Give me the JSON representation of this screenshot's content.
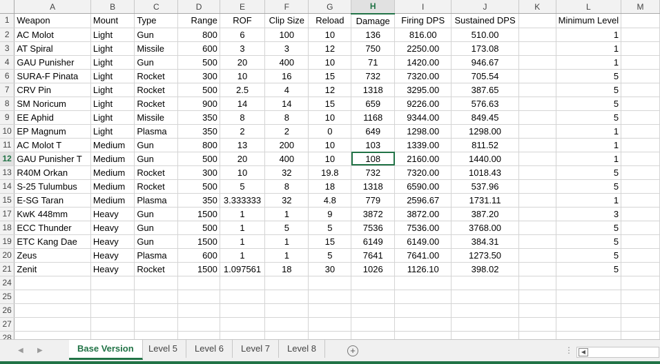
{
  "columns": [
    "A",
    "B",
    "C",
    "D",
    "E",
    "F",
    "G",
    "H",
    "I",
    "J",
    "K",
    "L",
    "M"
  ],
  "active_column": "H",
  "active_row": 12,
  "rows": [
    {
      "n": "1",
      "cells": [
        "Weapon",
        "Mount",
        "Type",
        "Range",
        "ROF",
        "Clip Size",
        "Reload",
        "Damage",
        "Firing DPS",
        "Sustained DPS",
        "",
        "Minimum Level",
        ""
      ]
    },
    {
      "n": "2",
      "cells": [
        "AC Molot",
        "Light",
        "Gun",
        "800",
        "6",
        "100",
        "10",
        "136",
        "816.00",
        "510.00",
        "",
        "1",
        ""
      ]
    },
    {
      "n": "3",
      "cells": [
        "AT Spiral",
        "Light",
        "Missile",
        "600",
        "3",
        "3",
        "12",
        "750",
        "2250.00",
        "173.08",
        "",
        "1",
        ""
      ]
    },
    {
      "n": "4",
      "cells": [
        "GAU Punisher",
        "Light",
        "Gun",
        "500",
        "20",
        "400",
        "10",
        "71",
        "1420.00",
        "946.67",
        "",
        "1",
        ""
      ]
    },
    {
      "n": "6",
      "cells": [
        "SURA-F Pinata",
        "Light",
        "Rocket",
        "300",
        "10",
        "16",
        "15",
        "732",
        "7320.00",
        "705.54",
        "",
        "5",
        ""
      ]
    },
    {
      "n": "7",
      "cells": [
        "CRV Pin",
        "Light",
        "Rocket",
        "500",
        "2.5",
        "4",
        "12",
        "1318",
        "3295.00",
        "387.65",
        "",
        "5",
        ""
      ]
    },
    {
      "n": "8",
      "cells": [
        "SM Noricum",
        "Light",
        "Rocket",
        "900",
        "14",
        "14",
        "15",
        "659",
        "9226.00",
        "576.63",
        "",
        "5",
        ""
      ]
    },
    {
      "n": "9",
      "cells": [
        "EE Aphid",
        "Light",
        "Missile",
        "350",
        "8",
        "8",
        "10",
        "1168",
        "9344.00",
        "849.45",
        "",
        "5",
        ""
      ]
    },
    {
      "n": "10",
      "cells": [
        "EP Magnum",
        "Light",
        "Plasma",
        "350",
        "2",
        "2",
        "0",
        "649",
        "1298.00",
        "1298.00",
        "",
        "1",
        ""
      ]
    },
    {
      "n": "11",
      "cells": [
        "AC Molot T",
        "Medium",
        "Gun",
        "800",
        "13",
        "200",
        "10",
        "103",
        "1339.00",
        "811.52",
        "",
        "1",
        ""
      ]
    },
    {
      "n": "12",
      "cells": [
        "GAU Punisher T",
        "Medium",
        "Gun",
        "500",
        "20",
        "400",
        "10",
        "108",
        "2160.00",
        "1440.00",
        "",
        "1",
        ""
      ]
    },
    {
      "n": "13",
      "cells": [
        "R40M Orkan",
        "Medium",
        "Rocket",
        "300",
        "10",
        "32",
        "19.8",
        "732",
        "7320.00",
        "1018.43",
        "",
        "5",
        ""
      ]
    },
    {
      "n": "14",
      "cells": [
        "S-25 Tulumbus",
        "Medium",
        "Rocket",
        "500",
        "5",
        "8",
        "18",
        "1318",
        "6590.00",
        "537.96",
        "",
        "5",
        ""
      ]
    },
    {
      "n": "15",
      "cells": [
        "E-SG Taran",
        "Medium",
        "Plasma",
        "350",
        "3.333333",
        "32",
        "4.8",
        "779",
        "2596.67",
        "1731.11",
        "",
        "1",
        ""
      ]
    },
    {
      "n": "17",
      "cells": [
        "KwK 448mm",
        "Heavy",
        "Gun",
        "1500",
        "1",
        "1",
        "9",
        "3872",
        "3872.00",
        "387.20",
        "",
        "3",
        ""
      ]
    },
    {
      "n": "18",
      "cells": [
        "ECC Thunder",
        "Heavy",
        "Gun",
        "500",
        "1",
        "5",
        "5",
        "7536",
        "7536.00",
        "3768.00",
        "",
        "5",
        ""
      ]
    },
    {
      "n": "19",
      "cells": [
        "ETC Kang Dae",
        "Heavy",
        "Gun",
        "1500",
        "1",
        "1",
        "15",
        "6149",
        "6149.00",
        "384.31",
        "",
        "5",
        ""
      ]
    },
    {
      "n": "20",
      "cells": [
        "Zeus",
        "Heavy",
        "Plasma",
        "600",
        "1",
        "1",
        "5",
        "7641",
        "7641.00",
        "1273.50",
        "",
        "5",
        ""
      ]
    },
    {
      "n": "21",
      "cells": [
        "Zenit",
        "Heavy",
        "Rocket",
        "1500",
        "1.097561",
        "18",
        "30",
        "1026",
        "1126.10",
        "398.02",
        "",
        "5",
        ""
      ]
    },
    {
      "n": "24",
      "cells": [
        "",
        "",
        "",
        "",
        "",
        "",
        "",
        "",
        "",
        "",
        "",
        "",
        ""
      ]
    },
    {
      "n": "25",
      "cells": [
        "",
        "",
        "",
        "",
        "",
        "",
        "",
        "",
        "",
        "",
        "",
        "",
        ""
      ]
    },
    {
      "n": "26",
      "cells": [
        "",
        "",
        "",
        "",
        "",
        "",
        "",
        "",
        "",
        "",
        "",
        "",
        ""
      ]
    },
    {
      "n": "27",
      "cells": [
        "",
        "",
        "",
        "",
        "",
        "",
        "",
        "",
        "",
        "",
        "",
        "",
        ""
      ]
    },
    {
      "n": "28",
      "cells": [
        "",
        "",
        "",
        "",
        "",
        "",
        "",
        "",
        "",
        "",
        "",
        "",
        ""
      ]
    }
  ],
  "sheet_tabs": [
    {
      "label": "Base Version",
      "active": true
    },
    {
      "label": "Level 5",
      "active": false
    },
    {
      "label": "Level 6",
      "active": false
    },
    {
      "label": "Level 7",
      "active": false
    },
    {
      "label": "Level 8",
      "active": false
    }
  ],
  "add_sheet_symbol": "+",
  "colors": {
    "accent": "#217346",
    "header_bg": "#f2f2f2",
    "gridline": "#d4d4d4"
  },
  "icons": [
    "scroll-left-icon",
    "scroll-right-icon",
    "add-sheet-icon",
    "more-options-icon",
    "scroll-thumb-icon"
  ]
}
